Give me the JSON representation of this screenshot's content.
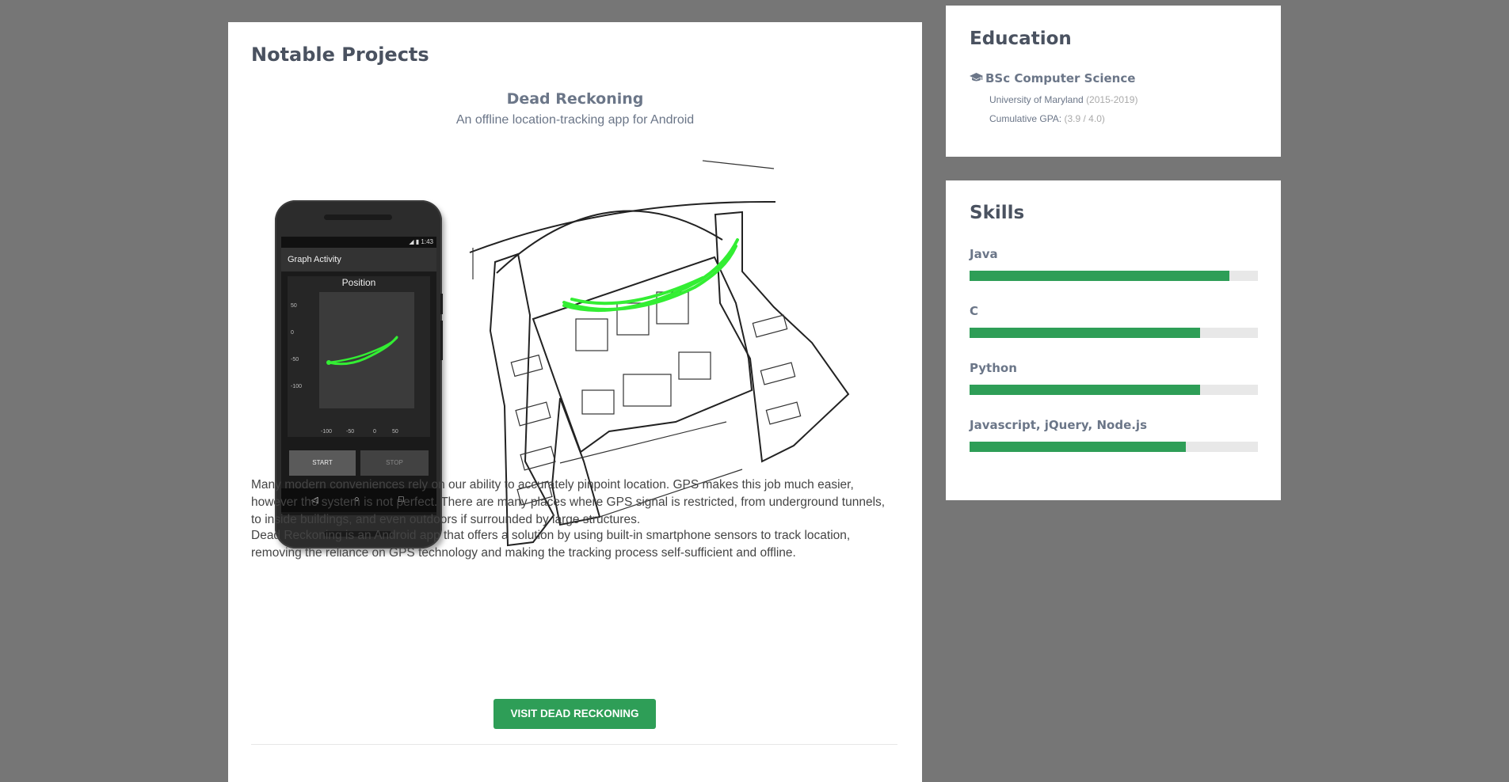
{
  "projects": {
    "section_title": "Notable Projects",
    "title": "Dead Reckoning",
    "subtitle": "An offline location-tracking app for Android",
    "phone": {
      "status_time": "1:43",
      "app_title": "Graph Activity",
      "plot_title": "Position",
      "y_ticks": [
        "50",
        "0",
        "-50",
        "-100"
      ],
      "x_ticks": [
        "-100",
        "-50",
        "0",
        "50"
      ],
      "start_label": "START",
      "stop_label": "STOP"
    },
    "paragraphs": [
      "Many modern conveniences rely on our ability to accurately pinpoint location. GPS makes this job much easier, however the system is not perfect. There are many places where GPS signal is restricted, from underground tunnels, to inside buildings, and even outdoors if surrounded by large structures.",
      "Dead Reckoning is an Android app that offers a solution by using built-in smartphone sensors to track location, removing the reliance on GPS technology and making the tracking process self-sufficient and offline."
    ],
    "button_label": "VISIT DEAD RECKONING"
  },
  "education": {
    "title": "Education",
    "degree": "BSc Computer Science",
    "school": "University of Maryland",
    "years": "(2015-2019)",
    "gpa_label": "Cumulative GPA:",
    "gpa_value": "(3.9 / 4.0)",
    "icon": "graduation-cap-icon"
  },
  "skills": {
    "title": "Skills",
    "items": [
      {
        "name": "Java",
        "level": 0.9
      },
      {
        "name": "C",
        "level": 0.8
      },
      {
        "name": "Python",
        "level": 0.8
      },
      {
        "name": "Javascript, jQuery, Node.js",
        "level": 0.75
      }
    ]
  },
  "colors": {
    "page_background": "#767676",
    "accent_green": "#2e9e57",
    "heading": "#4a5260",
    "muted_text": "#6b7688"
  }
}
